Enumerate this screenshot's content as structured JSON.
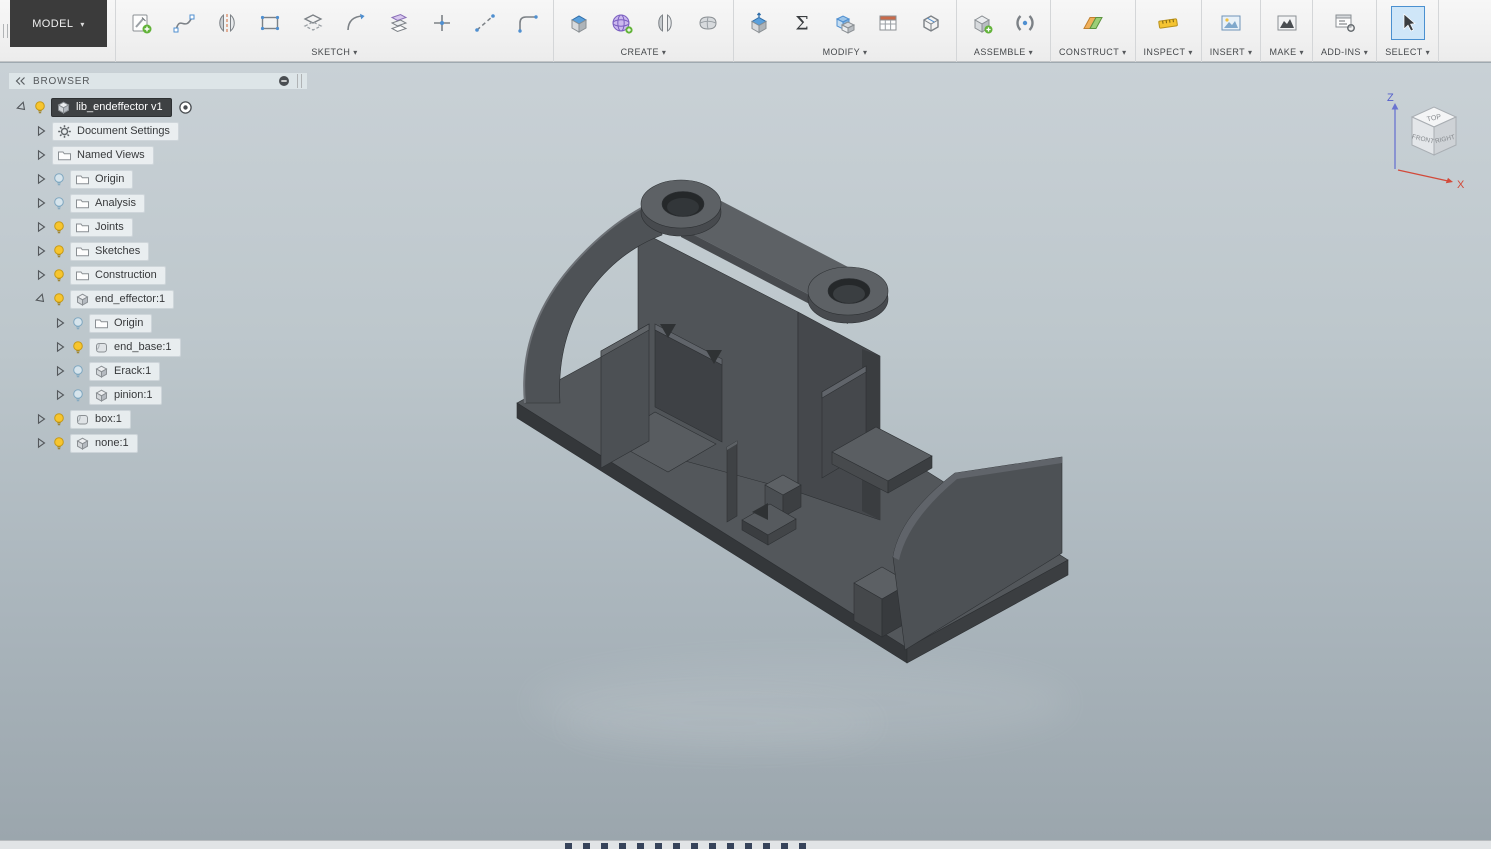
{
  "toolbar": {
    "model_menu": {
      "label": "MODEL"
    },
    "groups": [
      {
        "label": "SKETCH",
        "icons": [
          "create-sketch",
          "sketch-spline",
          "sketch-mirror",
          "sketch-rectangle",
          "sketch-offset",
          "sketch-arc",
          "sketch-project",
          "sketch-point",
          "sketch-construction-line",
          "sketch-fillet"
        ]
      },
      {
        "label": "CREATE",
        "icons": [
          "create-extrude",
          "create-form",
          "create-mirror",
          "create-tspline-box"
        ]
      },
      {
        "label": "MODIFY",
        "icons": [
          "press-pull",
          "change-parameters",
          "combine",
          "physical-material",
          "shell"
        ]
      },
      {
        "label": "ASSEMBLE",
        "icons": [
          "new-component",
          "joint"
        ]
      },
      {
        "label": "CONSTRUCT",
        "icons": [
          "construction-plane"
        ]
      },
      {
        "label": "INSPECT",
        "icons": [
          "measure"
        ]
      },
      {
        "label": "INSERT",
        "icons": [
          "insert-image"
        ]
      },
      {
        "label": "MAKE",
        "icons": [
          "make-3d-print"
        ]
      },
      {
        "label": "ADD-INS",
        "icons": [
          "scripts-addins"
        ]
      },
      {
        "label": "SELECT",
        "icons": [
          "select-cursor"
        ]
      }
    ]
  },
  "browser": {
    "title": "BROWSER",
    "tree": [
      {
        "label": "lib_endeffector v1",
        "level": 0,
        "icon": "component",
        "bulb": "on",
        "expander": "expanded",
        "selected": true,
        "has_target": true
      },
      {
        "label": "Document Settings",
        "level": 1,
        "icon": "gear",
        "bulb": null,
        "expander": "collapsed"
      },
      {
        "label": "Named Views",
        "level": 1,
        "icon": "folder",
        "bulb": null,
        "expander": "collapsed"
      },
      {
        "label": "Origin",
        "level": 1,
        "icon": "folder",
        "bulb": "off",
        "expander": "collapsed"
      },
      {
        "label": "Analysis",
        "level": 1,
        "icon": "folder",
        "bulb": "off",
        "expander": "collapsed"
      },
      {
        "label": "Joints",
        "level": 1,
        "icon": "folder",
        "bulb": "on",
        "expander": "collapsed"
      },
      {
        "label": "Sketches",
        "level": 1,
        "icon": "folder",
        "bulb": "on",
        "expander": "collapsed"
      },
      {
        "label": "Construction",
        "level": 1,
        "icon": "folder",
        "bulb": "on",
        "expander": "collapsed"
      },
      {
        "label": "end_effector:1",
        "level": 1,
        "icon": "component",
        "bulb": "on",
        "expander": "expanded"
      },
      {
        "label": "Origin",
        "level": 2,
        "icon": "folder",
        "bulb": "off",
        "expander": "collapsed"
      },
      {
        "label": "end_base:1",
        "level": 2,
        "icon": "body",
        "bulb": "on",
        "expander": "collapsed"
      },
      {
        "label": "Erack:1",
        "level": 2,
        "icon": "component",
        "bulb": "off",
        "expander": "collapsed"
      },
      {
        "label": "pinion:1",
        "level": 2,
        "icon": "component",
        "bulb": "off",
        "expander": "collapsed"
      },
      {
        "label": "box:1",
        "level": 1,
        "icon": "body",
        "bulb": "on",
        "expander": "collapsed"
      },
      {
        "label": "none:1",
        "level": 1,
        "icon": "component",
        "bulb": "on",
        "expander": "collapsed"
      }
    ]
  },
  "viewcube": {
    "top": "TOP",
    "front": "FRONT",
    "right": "RIGHT",
    "axis_z": "Z",
    "axis_x": "X"
  },
  "timeline": {
    "ticks": 14
  },
  "colors": {
    "accent_blue": "#4a90d0",
    "bulb_on": "#f7c52e",
    "bulb_off": "#cfdfe8",
    "model_gray": "#53575b",
    "canvas_top": "#c9d1d6",
    "canvas_bottom": "#9ba6ad"
  }
}
